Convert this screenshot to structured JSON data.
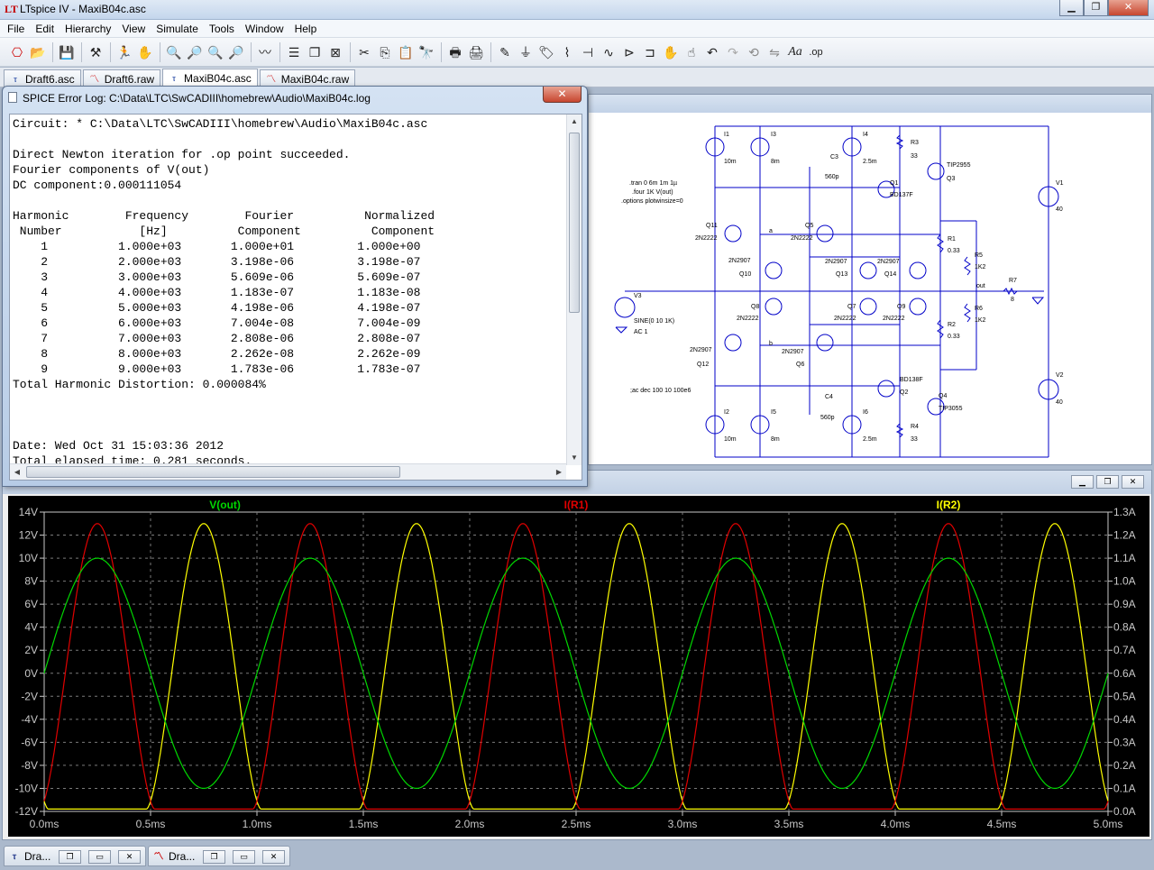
{
  "app": {
    "title": "LTspice IV - MaxiB04c.asc"
  },
  "window_controls": {
    "minimize": "▁",
    "maximize": "❐",
    "close": "✕"
  },
  "menu": [
    "File",
    "Edit",
    "Hierarchy",
    "View",
    "Simulate",
    "Tools",
    "Window",
    "Help"
  ],
  "toolbar_icons": [
    "new-schematic-icon",
    "open-icon",
    "save-icon",
    "control-panel-icon",
    "run-icon",
    "halt-icon",
    "zoom-in-icon",
    "zoom-full-icon",
    "zoom-out-icon",
    "zoom-cancel-icon",
    "autorange-icon",
    "tile-horizontal-icon",
    "cascade-icon",
    "close-all-icon",
    "cut-icon",
    "copy-icon",
    "paste-icon",
    "find-icon",
    "print-setup-icon",
    "print-icon",
    "wire-icon",
    "ground-icon",
    "label-icon",
    "resistor-icon",
    "capacitor-icon",
    "inductor-icon",
    "diode-icon",
    "component-icon",
    "move-icon",
    "drag-icon",
    "undo-icon",
    "redo-icon",
    "rotate-icon",
    "mirror-icon",
    "text-icon",
    "spice-directive-icon"
  ],
  "tabs": [
    {
      "label": "Draft6.asc",
      "icon": "schematic-icon"
    },
    {
      "label": "Draft6.raw",
      "icon": "waveform-icon"
    },
    {
      "label": "MaxiB04c.asc",
      "icon": "schematic-icon"
    },
    {
      "label": "MaxiB04c.raw",
      "icon": "waveform-icon"
    }
  ],
  "errorlog": {
    "title": "SPICE Error Log: C:\\Data\\LTC\\SwCADIII\\homebrew\\Audio\\MaxiB04c.log",
    "close": "✕",
    "lines": [
      "Circuit: * C:\\Data\\LTC\\SwCADIII\\homebrew\\Audio\\MaxiB04c.asc",
      "",
      "Direct Newton iteration for .op point succeeded.",
      "Fourier components of V(out)",
      "DC component:0.000111054",
      "",
      "Harmonic        Frequency        Fourier          Normalized",
      " Number           [Hz]          Component          Component",
      "    1          1.000e+03       1.000e+01         1.000e+00",
      "    2          2.000e+03       3.198e-06         3.198e-07",
      "    3          3.000e+03       5.609e-06         5.609e-07",
      "    4          4.000e+03       1.183e-07         1.183e-08",
      "    5          5.000e+03       4.198e-06         4.198e-07",
      "    6          6.000e+03       7.004e-08         7.004e-09",
      "    7          7.000e+03       2.808e-06         2.808e-07",
      "    8          8.000e+03       2.262e-08         2.262e-09",
      "    9          9.000e+03       1.783e-06         1.783e-07",
      "Total Harmonic Distortion: 0.000084%",
      "",
      "",
      "",
      "Date: Wed Oct 31 15:03:36 2012",
      "Total elapsed time: 0.281 seconds."
    ]
  },
  "schematic": {
    "directives": [
      ".tran 0 6m 1m 1µ",
      ".four 1K V(out)",
      ".options plotwinsize=0",
      ";ac dec 100 10 100e6"
    ],
    "components": [
      {
        "ref": "I1",
        "value": "10m"
      },
      {
        "ref": "I3",
        "value": "8m"
      },
      {
        "ref": "I4",
        "value": "2.5m"
      },
      {
        "ref": "R3",
        "value": "33"
      },
      {
        "ref": "C3",
        "value": "560p"
      },
      {
        "ref": "Q1",
        "value": "BD137F"
      },
      {
        "ref": "Q3",
        "value": "TIP2955"
      },
      {
        "ref": "V1",
        "value": "40"
      },
      {
        "ref": "Q11",
        "value": "2N2222"
      },
      {
        "ref": "Q5",
        "value": "2N2222"
      },
      {
        "ref": "Q10",
        "value": "2N2907"
      },
      {
        "ref": "Q13",
        "value": "2N2907"
      },
      {
        "ref": "Q14",
        "value": "2N2907"
      },
      {
        "ref": "R1",
        "value": "0.33"
      },
      {
        "ref": "R5",
        "value": "1K2"
      },
      {
        "ref": "R7",
        "value": "8"
      },
      {
        "ref": "V3",
        "value": "SINE(0 10 1K)"
      },
      {
        "ref": "Q8",
        "value": "2N2222"
      },
      {
        "ref": "Q7",
        "value": "2N2222"
      },
      {
        "ref": "Q9",
        "value": "2N2222"
      },
      {
        "ref": "R2",
        "value": "0.33"
      },
      {
        "ref": "R6",
        "value": "1K2"
      },
      {
        "ref": "Q12",
        "value": "2N2907"
      },
      {
        "ref": "Q6",
        "value": "2N2907"
      },
      {
        "ref": "Q2",
        "value": "BD138F"
      },
      {
        "ref": "Q4",
        "value": "TIP3055"
      },
      {
        "ref": "C4",
        "value": "560p"
      },
      {
        "ref": "I2",
        "value": "10m"
      },
      {
        "ref": "I5",
        "value": "8m"
      },
      {
        "ref": "I6",
        "value": "2.5m"
      },
      {
        "ref": "R4",
        "value": "33"
      },
      {
        "ref": "V2",
        "value": "40"
      }
    ],
    "labels": {
      "ac": "AC 1",
      "out": "out",
      "a": "a",
      "b": "b"
    }
  },
  "chart_data": {
    "type": "line",
    "x": {
      "label": "",
      "range": [
        0,
        5.0
      ],
      "unit": "ms",
      "ticks": [
        "0.0ms",
        "0.5ms",
        "1.0ms",
        "1.5ms",
        "2.0ms",
        "2.5ms",
        "3.0ms",
        "3.5ms",
        "4.0ms",
        "4.5ms",
        "5.0ms"
      ]
    },
    "y_left": {
      "range": [
        -12,
        14
      ],
      "ticks": [
        "14V",
        "12V",
        "10V",
        "8V",
        "6V",
        "4V",
        "2V",
        "0V",
        "-2V",
        "-4V",
        "-6V",
        "-8V",
        "-10V",
        "-12V"
      ]
    },
    "y_right": {
      "range": [
        0.0,
        1.3
      ],
      "ticks": [
        "1.3A",
        "1.2A",
        "1.1A",
        "1.0A",
        "0.9A",
        "0.8A",
        "0.7A",
        "0.6A",
        "0.5A",
        "0.4A",
        "0.3A",
        "0.2A",
        "0.1A",
        "0.0A"
      ]
    },
    "grid": true,
    "background": "#000000",
    "series": [
      {
        "name": "V(out)",
        "color": "#00d800",
        "axis": "left",
        "frequency_hz": 1000,
        "amplitude": 10,
        "offset": 0,
        "phase": "sine"
      },
      {
        "name": "I(R1)",
        "color": "#e00000",
        "axis": "right",
        "frequency_hz": 1000,
        "peak": 1.25,
        "baseline": 0.01,
        "conduction": "positive half-cycle"
      },
      {
        "name": "I(R2)",
        "color": "#ffff00",
        "axis": "right",
        "frequency_hz": 1000,
        "peak": 1.25,
        "baseline": 0.01,
        "conduction": "negative half-cycle"
      }
    ]
  },
  "minimized": [
    {
      "label": "Dra...",
      "icon": "schematic-icon"
    },
    {
      "label": "Dra...",
      "icon": "waveform-icon"
    }
  ],
  "mdi_controls": [
    "❐",
    "▭",
    "✕"
  ]
}
